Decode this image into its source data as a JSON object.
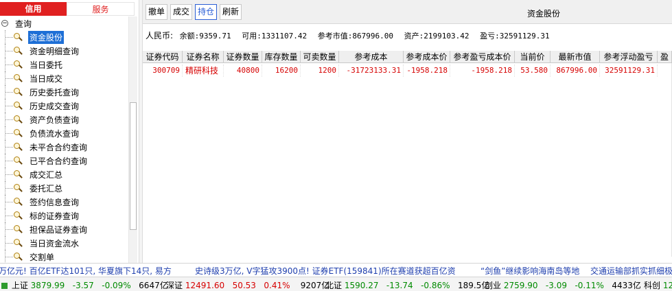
{
  "left_tabs": {
    "credit": "信用",
    "service": "服务"
  },
  "tree": {
    "root_toggle": "−",
    "root_label": "查询",
    "items": [
      "资金股份",
      "资金明细查询",
      "当日委托",
      "当日成交",
      "历史委托查询",
      "历史成交查询",
      "资产负债查询",
      "负债流水查询",
      "未平合合约查询",
      "已平合合约查询",
      "成交汇总",
      "委托汇总",
      "签约信息查询",
      "标的证券查询",
      "担保品证券查询",
      "当日资金流水",
      "交割单"
    ],
    "selected": "资金股份"
  },
  "toolbar": {
    "cancel": "撤单",
    "deal": "成交",
    "hold": "持仓",
    "refresh": "刷新"
  },
  "panel_title": "资金股份",
  "summary": {
    "currency": "人民币:",
    "balance": "余额:9359.71",
    "available": "可用:1331107.42",
    "market_value": "参考市值:867996.00",
    "assets": "资产:2199103.42",
    "pnl": "盈亏:32591129.31"
  },
  "table": {
    "headers": [
      "证券代码",
      "证券名称",
      "证券数量",
      "库存数量",
      "可卖数量",
      "参考成本",
      "参考成本价",
      "参考盈亏成本价",
      "当前价",
      "最新市值",
      "参考浮动盈亏",
      "盈"
    ],
    "rows": [
      [
        "300709",
        "精研科技",
        "40800",
        "16200",
        "1200",
        "-31723133.31",
        "-1958.218",
        "-1958.218",
        "53.580",
        "867996.00",
        "32591129.31",
        ""
      ]
    ]
  },
  "news": [
    "万亿元! 百亿ETF达101只, 华夏旗下14只, 易方",
    "史诗级3万亿, V字猛攻3900点! 证券ETF(159841)所在赛道获超百亿资",
    "“剑鱼”继续影响海南岛等地",
    "交通运输部抓实抓细极"
  ],
  "market": [
    {
      "name": "上证",
      "price": "3879.99",
      "change": "-3.57",
      "pct": "-0.09%",
      "volume": "6647亿",
      "dir": "down",
      "color": "#2e9b2e"
    },
    {
      "name": "深证",
      "price": "12491.60",
      "change": "50.53",
      "pct": "0.41%",
      "volume": "9207亿",
      "dir": "up",
      "color": ""
    },
    {
      "name": "北证",
      "price": "1590.27",
      "change": "-13.74",
      "pct": "-0.86%",
      "volume": "189.5亿",
      "dir": "down",
      "color": ""
    },
    {
      "name": "创业",
      "price": "2759.90",
      "change": "-3.09",
      "pct": "-0.11%",
      "volume": "4433亿",
      "dir": "down",
      "color": ""
    },
    {
      "name": "科创",
      "price": "12",
      "change": "",
      "pct": "",
      "volume": "",
      "dir": "down",
      "color": ""
    }
  ]
}
